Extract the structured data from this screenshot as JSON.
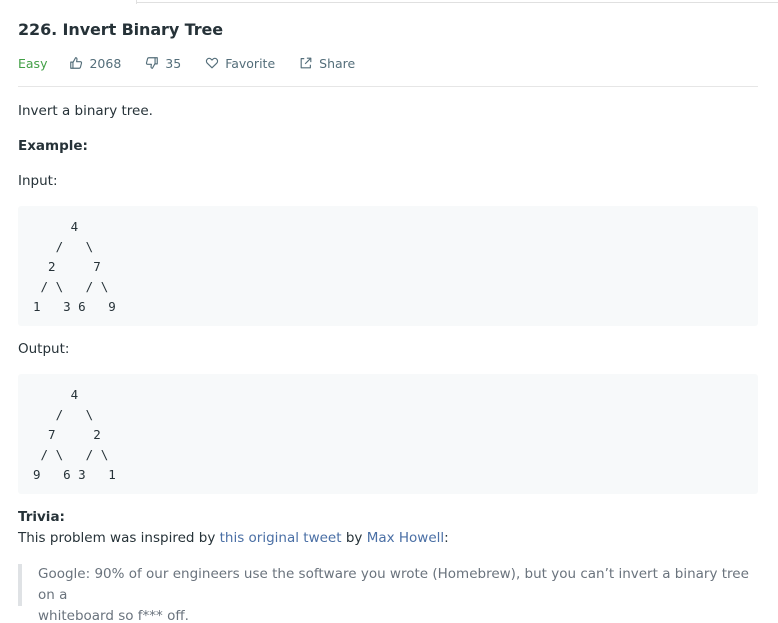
{
  "problem": {
    "title": "226. Invert Binary Tree",
    "difficulty": "Easy",
    "likes": "2068",
    "dislikes": "35",
    "favorite_label": "Favorite",
    "share_label": "Share"
  },
  "description": {
    "intro": "Invert a binary tree.",
    "example_heading": "Example:",
    "input_label": "Input:",
    "input_tree": "     4\n   /   \\\n  2     7\n / \\   / \\\n1   3 6   9",
    "output_label": "Output:",
    "output_tree": "     4\n   /   \\\n  7     2\n / \\   / \\\n9   6 3   1",
    "trivia_heading": "Trivia:",
    "trivia_prefix": "This problem was inspired by ",
    "trivia_link1": "this original tweet",
    "trivia_middle": " by ",
    "trivia_link2": "Max Howell",
    "trivia_suffix": ":",
    "quote_line1": "Google: 90% of our engineers use the software you wrote (Homebrew), but you can’t invert a binary tree on a",
    "quote_line2": "whiteboard so f*** off."
  },
  "colors": {
    "easy": "#43a047",
    "text": "#263238",
    "muted": "#546e7a",
    "code_bg": "#f7f9fa"
  },
  "icons": {
    "likes": "thumbs-up-icon",
    "dislikes": "thumbs-down-icon",
    "favorite": "heart-icon",
    "share": "share-icon"
  }
}
